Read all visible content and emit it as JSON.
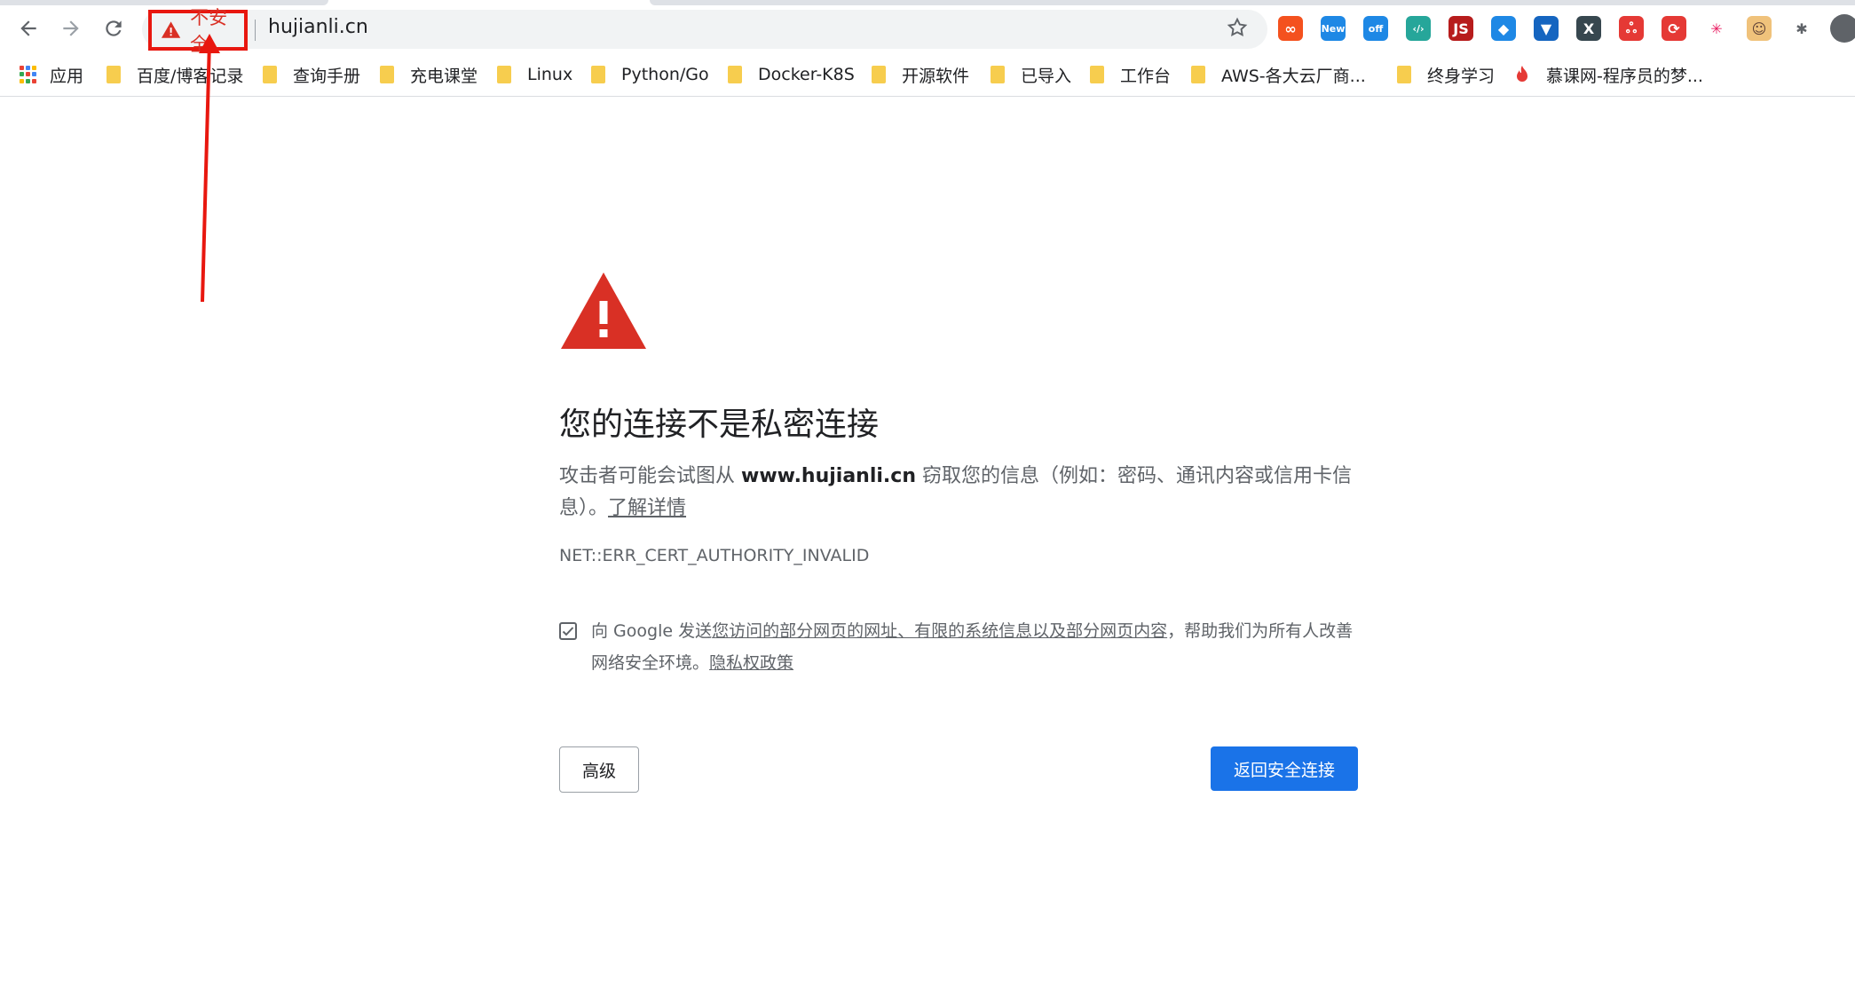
{
  "toolbar": {
    "back_icon": "arrow-left-icon",
    "forward_icon": "arrow-right-icon",
    "reload_icon": "reload-icon",
    "security_label": "不安全",
    "url": "hujianli.cn",
    "bookmark_star_icon": "star-icon",
    "extensions": [
      {
        "name": "infinity-extension-icon",
        "color": "#f4511e",
        "label": "∞"
      },
      {
        "name": "new-extension-icon",
        "color": "#1e88e5",
        "label": "New"
      },
      {
        "name": "off-extension-icon",
        "color": "#1e88e5",
        "label": "off"
      },
      {
        "name": "code-extension-icon",
        "color": "#26a69a",
        "label": "‹/›"
      },
      {
        "name": "js-extension-icon",
        "color": "#b71c1c",
        "label": "JS"
      },
      {
        "name": "leaf-extension-icon",
        "color": "#1e88e5",
        "label": "◆"
      },
      {
        "name": "pocket-extension-icon",
        "color": "#1565c0",
        "label": "▼"
      },
      {
        "name": "x-extension-icon",
        "color": "#37474f",
        "label": "X"
      },
      {
        "name": "network-extension-icon",
        "color": "#e53935",
        "label": "ஃ"
      },
      {
        "name": "sync-extension-icon",
        "color": "#e53935",
        "label": "⟳"
      },
      {
        "name": "color-star-extension-icon",
        "color": "#ffffff",
        "label": "✳"
      },
      {
        "name": "face-extension-icon",
        "color": "#f0c27b",
        "label": "☺"
      },
      {
        "name": "puzzle-extensions-icon",
        "color": "#ffffff",
        "label": "✱"
      }
    ]
  },
  "bookmarks": {
    "apps_label": "应用",
    "items": [
      {
        "label": "百度/博客记录"
      },
      {
        "label": "查询手册"
      },
      {
        "label": "充电课堂"
      },
      {
        "label": "Linux"
      },
      {
        "label": "Python/Go"
      },
      {
        "label": "Docker-K8S"
      },
      {
        "label": "开源软件"
      },
      {
        "label": "已导入"
      },
      {
        "label": "工作台"
      },
      {
        "label": "AWS-各大云厂商..."
      },
      {
        "label": "终身学习"
      },
      {
        "label": "慕课网-程序员的梦..."
      }
    ]
  },
  "interstitial": {
    "title": "您的连接不是私密连接",
    "desc_prefix": "攻击者可能会试图从 ",
    "desc_domain": "www.hujianli.cn",
    "desc_suffix": " 窃取您的信息（例如：密码、通讯内容或信用卡信息）。",
    "learn_more": "了解详情",
    "error_code": "NET::ERR_CERT_AUTHORITY_INVALID",
    "report_prefix": "向 Google 发送",
    "report_link": "您访问的部分网页的网址、有限的系统信息以及部分网页内容",
    "report_suffix": "，帮助我们为所有人改善网络安全环境。",
    "privacy_link": "隐私权政策",
    "report_checked": true,
    "advanced_button": "高级",
    "back_button": "返回安全连接"
  },
  "colors": {
    "danger": "#d93025",
    "annotation_red": "#e8170f",
    "primary": "#1a73e8",
    "folder": "#f7cd4e"
  }
}
